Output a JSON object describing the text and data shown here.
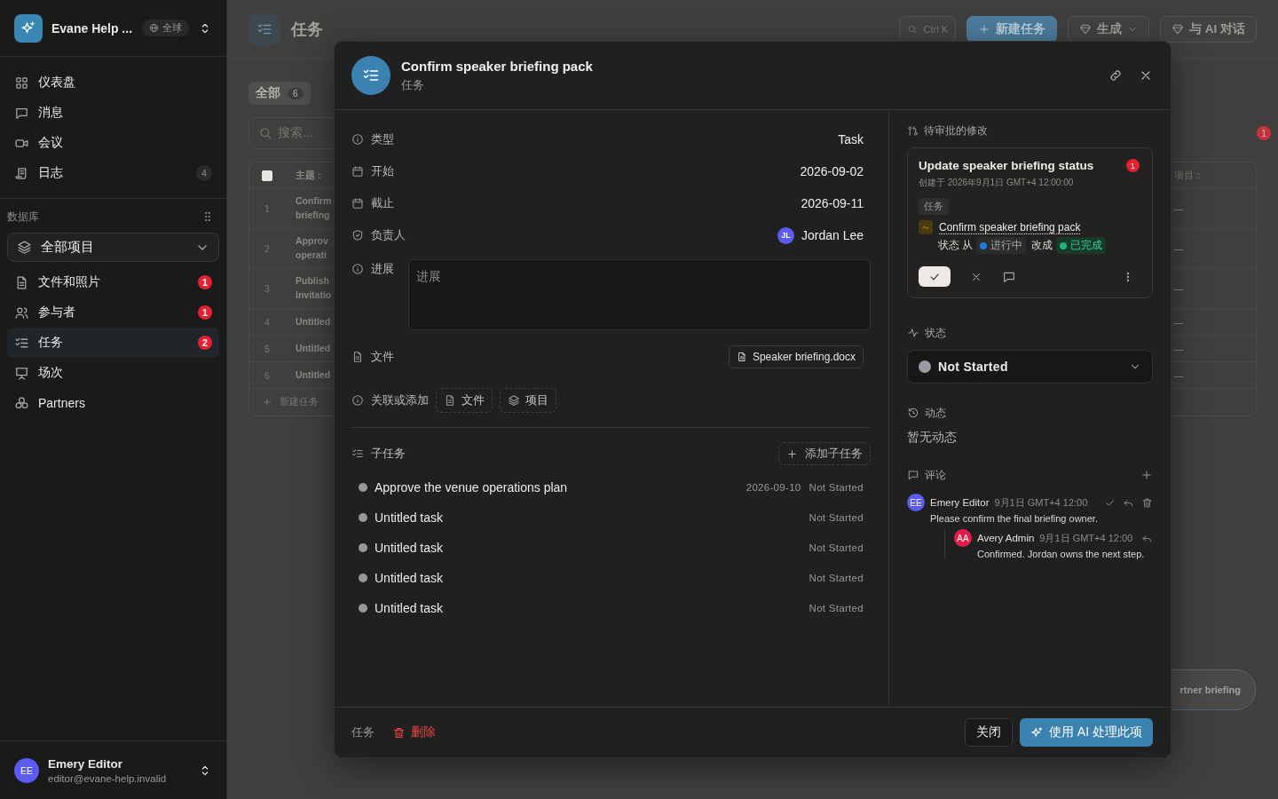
{
  "sidebar": {
    "workspace": {
      "name": "Evane Help ...",
      "scope": "全球"
    },
    "nav": [
      {
        "label": "仪表盘",
        "selected": false
      },
      {
        "label": "消息",
        "selected": false
      },
      {
        "label": "会议",
        "selected": false
      },
      {
        "label": "日志",
        "selected": false,
        "badge": {
          "text": "4",
          "kind": "count"
        }
      }
    ],
    "section_title": "数据库",
    "database_select": {
      "value": "全部项目"
    },
    "items": [
      {
        "label": "文件和照片",
        "selected": false,
        "badge": {
          "text": "1",
          "kind": "alert"
        }
      },
      {
        "label": "参与者",
        "selected": false,
        "badge": {
          "text": "1",
          "kind": "alert"
        }
      },
      {
        "label": "任务",
        "selected": true,
        "badge": {
          "text": "2",
          "kind": "alert"
        }
      },
      {
        "label": "场次",
        "selected": false
      },
      {
        "label": "Partners",
        "selected": false
      }
    ],
    "user": {
      "initials": "EE",
      "name": "Emery Editor",
      "email": "editor@evane-help.invalid"
    }
  },
  "page": {
    "title": "任务",
    "search_shortcut": "Ctrl K",
    "buttons": [
      {
        "label": "新建任务",
        "kind": "primary"
      },
      {
        "label": "生成",
        "kind": "menu"
      },
      {
        "label": "与 AI 对话",
        "kind": "plain"
      }
    ],
    "filters": [
      {
        "label": "全部",
        "count": "6",
        "selected": true
      }
    ],
    "search": {
      "placeholder": "搜索..."
    },
    "notification_badge": "1",
    "table": {
      "select_all": {
        "checked": false
      },
      "columns": [
        {
          "label": "主题"
        },
        {
          "label": "项目"
        }
      ],
      "rows": [
        {
          "number": "1",
          "subject": "Confirm briefing",
          "project": "—"
        },
        {
          "number": "2",
          "subject": "Approv operati",
          "project": "—"
        },
        {
          "number": "3",
          "subject": "Publish invitatio",
          "project": "—"
        },
        {
          "number": "4",
          "subject": "Untitled",
          "project": "—"
        },
        {
          "number": "5",
          "subject": "Untitled",
          "project": "—"
        },
        {
          "number": "6",
          "subject": "Untitled",
          "project": "—"
        }
      ],
      "add_row": "新建任务"
    },
    "floating_button": "rtner briefing"
  },
  "modal": {
    "title": "Confirm speaker briefing pack",
    "subtitle": "任务",
    "properties": [
      {
        "kind": "text",
        "label": "类型",
        "value": "Task"
      },
      {
        "kind": "date",
        "label": "开始",
        "value": "2026-09-02"
      },
      {
        "kind": "date",
        "label": "截止",
        "value": "2026-09-11"
      },
      {
        "kind": "person",
        "label": "负责人",
        "value": "Jordan Lee",
        "initials": "JL"
      },
      {
        "kind": "notes",
        "label": "进展",
        "placeholder": "进展"
      },
      {
        "kind": "file",
        "label": "文件",
        "value": "Speaker briefing.docx"
      },
      {
        "kind": "links",
        "label": "关联或添加",
        "options": [
          "文件",
          "项目"
        ]
      }
    ],
    "subtasks": {
      "title": "子任务",
      "add_label": "添加子任务",
      "items": [
        {
          "name": "Approve the venue operations plan",
          "due": "2026-09-10",
          "status": "Not Started"
        },
        {
          "name": "Untitled task",
          "status": "Not Started"
        },
        {
          "name": "Untitled task",
          "status": "Not Started"
        },
        {
          "name": "Untitled task",
          "status": "Not Started"
        },
        {
          "name": "Untitled task",
          "status": "Not Started"
        }
      ]
    },
    "pending": {
      "title": "待审批的修改",
      "changes": [
        {
          "title": "Update speaker briefing status",
          "badge": "1",
          "created": "创建于 2026年9月1日 GMT+4 12:00:00",
          "tag": "任务",
          "target": "Confirm speaker briefing pack",
          "field": "状态 从",
          "from": {
            "label": "进行中",
            "color": "#1f7ae0"
          },
          "connector": "改成",
          "to": {
            "label": "已完成",
            "color": "#22b573"
          }
        }
      ]
    },
    "status": {
      "title": "状态",
      "value": "Not Started"
    },
    "activity": {
      "title": "动态",
      "empty": "暂无动态"
    },
    "comments": {
      "title": "评论",
      "items": [
        {
          "initials": "EE",
          "author": "Emery Editor",
          "color": "#5b5bf0",
          "time": "9月1日 GMT+4 12:00",
          "text": "Please confirm the final briefing owner.",
          "resolvable": true,
          "children": [
            {
              "initials": "AA",
              "author": "Avery Admin",
              "color": "#e11d48",
              "time": "9月1日 GMT+4 12:00",
              "text": "Confirmed. Jordan owns the next step.",
              "resolvable": false
            }
          ]
        }
      ]
    },
    "footer": {
      "type": "任务",
      "delete": "删除",
      "close": "关闭",
      "ai": "使用 AI 处理此项"
    }
  }
}
